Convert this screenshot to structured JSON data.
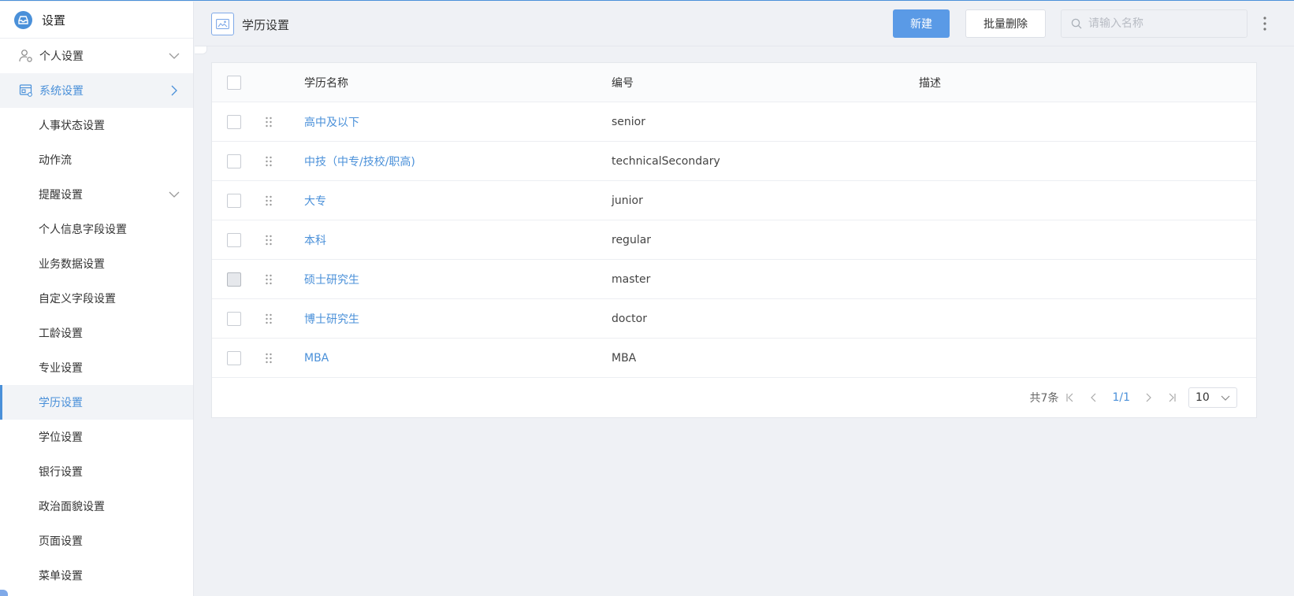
{
  "sidebar": {
    "title": "设置",
    "items": [
      {
        "label": "个人设置",
        "level": "top",
        "icon": "user-gear-icon",
        "chevron": "down"
      },
      {
        "label": "系统设置",
        "level": "top",
        "icon": "system-settings-icon",
        "chevron": "right"
      },
      {
        "label": "人事状态设置"
      },
      {
        "label": "动作流"
      },
      {
        "label": "提醒设置",
        "chevron": "down"
      },
      {
        "label": "个人信息字段设置"
      },
      {
        "label": "业务数据设置"
      },
      {
        "label": "自定义字段设置"
      },
      {
        "label": "工龄设置"
      },
      {
        "label": "专业设置"
      },
      {
        "label": "学历设置",
        "active": true
      },
      {
        "label": "学位设置"
      },
      {
        "label": "银行设置"
      },
      {
        "label": "政治面貌设置"
      },
      {
        "label": "页面设置"
      },
      {
        "label": "菜单设置"
      }
    ]
  },
  "header": {
    "title": "学历设置",
    "new_label": "新建",
    "batch_delete_label": "批量删除",
    "search_placeholder": "请输入名称"
  },
  "table": {
    "columns": [
      "学历名称",
      "编号",
      "描述"
    ],
    "rows": [
      {
        "name": "高中及以下",
        "code": "senior",
        "desc": ""
      },
      {
        "name": "中技（中专/技校/职高)",
        "code": "technicalSecondary",
        "desc": ""
      },
      {
        "name": "大专",
        "code": "junior",
        "desc": ""
      },
      {
        "name": "本科",
        "code": "regular",
        "desc": ""
      },
      {
        "name": "硕士研究生",
        "code": "master",
        "desc": ""
      },
      {
        "name": "博士研究生",
        "code": "doctor",
        "desc": ""
      },
      {
        "name": "MBA",
        "code": "MBA",
        "desc": ""
      }
    ]
  },
  "pagination": {
    "total_label": "共7条",
    "page": "1/1",
    "page_size": "10"
  },
  "colors": {
    "accent": "#4a90d9",
    "primary_button": "#5a9ae6",
    "background": "#eff1f5"
  }
}
